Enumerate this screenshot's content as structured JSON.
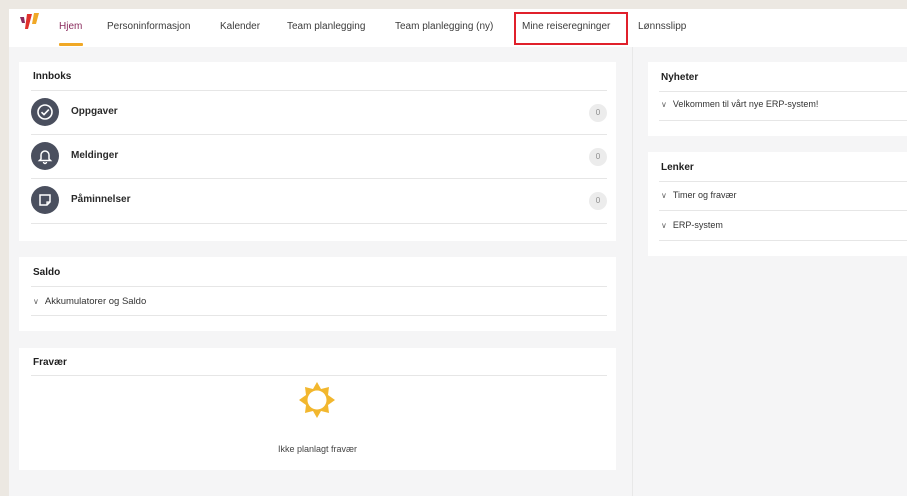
{
  "nav": {
    "items": [
      {
        "label": "Hjem"
      },
      {
        "label": "Personinformasjon"
      },
      {
        "label": "Kalender"
      },
      {
        "label": "Team planlegging"
      },
      {
        "label": "Team planlegging (ny)"
      },
      {
        "label": "Mine reiseregninger"
      },
      {
        "label": "Lønnsslipp"
      }
    ],
    "active_color": "#8a2b5d",
    "underline_color": "#f0a826",
    "highlight_color": "#e0202b"
  },
  "inbox": {
    "title": "Innboks",
    "rows": [
      {
        "label": "Oppgaver",
        "count": "0",
        "icon": "check-circle-icon"
      },
      {
        "label": "Meldinger",
        "count": "0",
        "icon": "bell-icon"
      },
      {
        "label": "Påminnelser",
        "count": "0",
        "icon": "note-icon"
      }
    ]
  },
  "saldo": {
    "title": "Saldo",
    "item": "Akkumulatorer og Saldo"
  },
  "fravaer": {
    "title": "Fravær",
    "empty_text": "Ikke planlagt fravær",
    "icon": "sun-icon",
    "icon_color": "#f2b72e"
  },
  "nyheter": {
    "title": "Nyheter",
    "item": "Velkommen til vårt nye ERP-system!"
  },
  "lenker": {
    "title": "Lenker",
    "items": [
      "Timer og fravær",
      "ERP-system"
    ]
  }
}
